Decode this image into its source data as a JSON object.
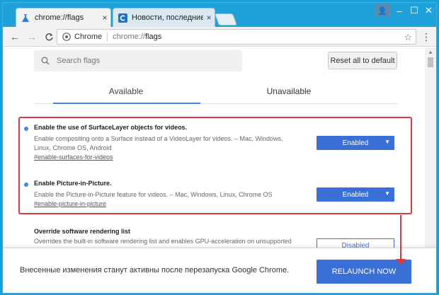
{
  "browser": {
    "tabs": [
      {
        "title": "chrome://flags",
        "close": "×"
      },
      {
        "title": "Новости, последние нов",
        "close": "×"
      }
    ],
    "toolbar": {
      "back": "←",
      "forward": "→",
      "reload": "C",
      "site_name": "Chrome",
      "url_scheme": "chrome://",
      "url_path": "flags",
      "star": "☆",
      "menu": "⋮"
    },
    "window_controls": {
      "profile": "👤",
      "minimize": "–",
      "maximize": "☐",
      "close": "✕"
    }
  },
  "page": {
    "search": {
      "placeholder": "Search flags"
    },
    "reset_button": "Reset all to default",
    "tabs": {
      "available": "Available",
      "unavailable": "Unavailable"
    },
    "flags": [
      {
        "name": "Enable the use of SurfaceLayer objects for videos.",
        "description": "Enable compositing onto a Surface instead of a VideoLayer for videos. – Mac, Windows, Linux, Chrome OS, Android",
        "link": "#enable-surfaces-for-videos",
        "value": "Enabled",
        "caret": "▼"
      },
      {
        "name": "Enable Picture-in-Picture.",
        "description": "Enable the Picture-in-Picture feature for videos. – Mac, Windows, Linux, Chrome OS",
        "link": "#enable-picture-in-picture",
        "value": "Enabled",
        "caret": "▼"
      },
      {
        "name": "Override software rendering list",
        "description": "Overrides the built-in software rendering list and enables GPU-acceleration on unsupported",
        "value": "Disabled"
      }
    ],
    "relaunch": {
      "message": "Внесенные изменения станут активны после перезапуска Google Chrome.",
      "button": "RELAUNCH NOW"
    }
  },
  "colors": {
    "accent": "#3a6fd8",
    "highlight": "#e0393d",
    "titlebar": "#1ea2d9"
  }
}
